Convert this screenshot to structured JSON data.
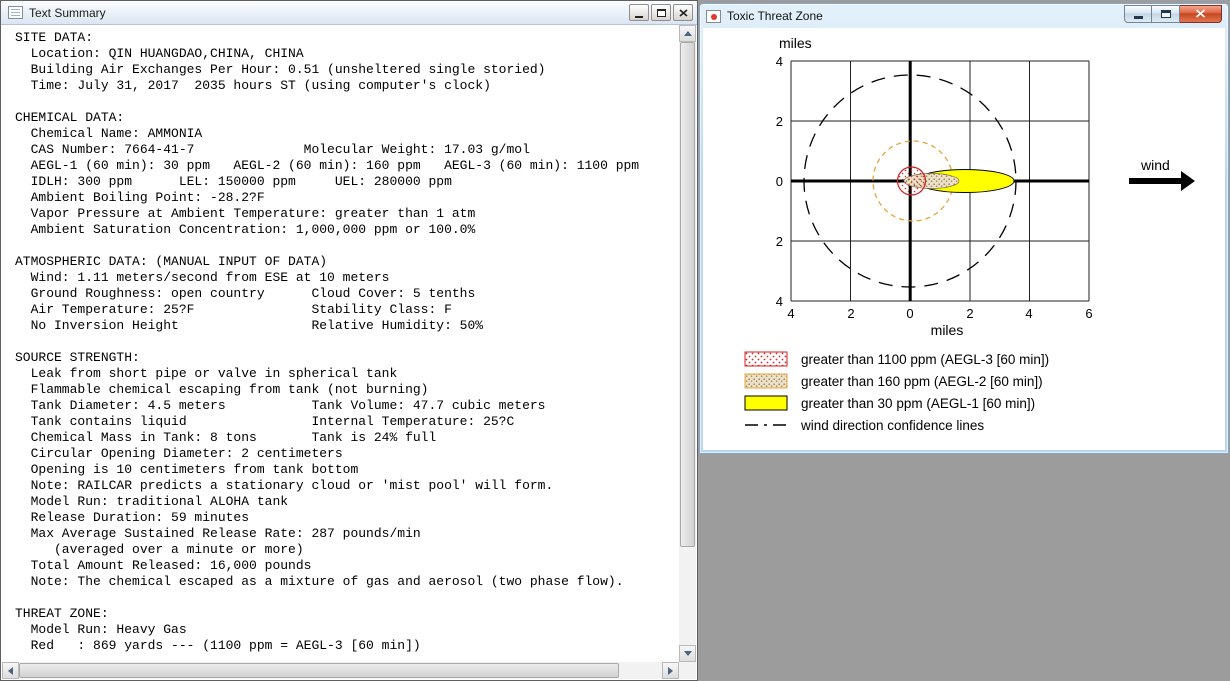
{
  "desktop": {
    "background_color": "#9c9c9c"
  },
  "text_summary_window": {
    "title": "Text Summary",
    "lines": [
      "SITE DATA:",
      "  Location: QIN HUANGDAO,CHINA, CHINA",
      "  Building Air Exchanges Per Hour: 0.51 (unsheltered single storied)",
      "  Time: July 31, 2017  2035 hours ST (using computer's clock)",
      "",
      "CHEMICAL DATA:",
      "  Chemical Name: AMMONIA",
      "  CAS Number: 7664-41-7              Molecular Weight: 17.03 g/mol",
      "  AEGL-1 (60 min): 30 ppm   AEGL-2 (60 min): 160 ppm   AEGL-3 (60 min): 1100 ppm",
      "  IDLH: 300 ppm      LEL: 150000 ppm     UEL: 280000 ppm",
      "  Ambient Boiling Point: -28.2?F",
      "  Vapor Pressure at Ambient Temperature: greater than 1 atm",
      "  Ambient Saturation Concentration: 1,000,000 ppm or 100.0%",
      "",
      "ATMOSPHERIC DATA: (MANUAL INPUT OF DATA)",
      "  Wind: 1.11 meters/second from ESE at 10 meters",
      "  Ground Roughness: open country      Cloud Cover: 5 tenths",
      "  Air Temperature: 25?F               Stability Class: F",
      "  No Inversion Height                 Relative Humidity: 50%",
      "",
      "SOURCE STRENGTH:",
      "  Leak from short pipe or valve in spherical tank",
      "  Flammable chemical escaping from tank (not burning)",
      "  Tank Diameter: 4.5 meters           Tank Volume: 47.7 cubic meters",
      "  Tank contains liquid                Internal Temperature: 25?C",
      "  Chemical Mass in Tank: 8 tons       Tank is 24% full",
      "  Circular Opening Diameter: 2 centimeters",
      "  Opening is 10 centimeters from tank bottom",
      "  Note: RAILCAR predicts a stationary cloud or 'mist pool' will form.",
      "  Model Run: traditional ALOHA tank",
      "  Release Duration: 59 minutes",
      "  Max Average Sustained Release Rate: 287 pounds/min",
      "     (averaged over a minute or more)",
      "  Total Amount Released: 16,000 pounds",
      "  Note: The chemical escaped as a mixture of gas and aerosol (two phase flow).",
      "",
      "THREAT ZONE:",
      "  Model Run: Heavy Gas",
      "  Red   : 869 yards --- (1100 ppm = AEGL-3 [60 min])"
    ]
  },
  "threat_zone_window": {
    "title": "Toxic Threat Zone",
    "plot": {
      "y_axis_title": "miles",
      "x_axis_title": "miles",
      "y_ticks": [
        "4",
        "2",
        "0",
        "2",
        "4"
      ],
      "x_ticks": [
        "4",
        "2",
        "0",
        "2",
        "4",
        "6"
      ],
      "wind_label": "wind"
    },
    "legend": [
      {
        "label": "greater than 1100 ppm (AEGL-3 [60 min])"
      },
      {
        "label": "greater than 160 ppm (AEGL-2 [60 min])"
      },
      {
        "label": "greater than 30 ppm (AEGL-1 [60 min])"
      },
      {
        "label": "wind direction confidence lines"
      }
    ],
    "chart_data": {
      "type": "area",
      "title": "Toxic Threat Zone",
      "xlabel": "miles",
      "ylabel": "miles",
      "xlim": [
        -4,
        6
      ],
      "ylim": [
        -4,
        4
      ],
      "grid": true,
      "wind": {
        "arrow_label": "wind",
        "blowing_toward": "+x direction of plot"
      },
      "zones": [
        {
          "name": "AEGL-3",
          "threshold_label": "greater than 1100 ppm (AEGL-3 [60 min])",
          "downwind_extent_miles": 0.49,
          "shape": "small red dotted circle at origin"
        },
        {
          "name": "AEGL-2",
          "threshold_label": "greater than 160 ppm (AEGL-2 [60 min])",
          "downwind_extent_miles": 1.6,
          "shape": "stippled lobe along +x axis"
        },
        {
          "name": "AEGL-1",
          "threshold_label": "greater than 30 ppm (AEGL-1 [60 min])",
          "downwind_extent_miles": 3.5,
          "shape": "solid yellow lobe along +x axis"
        }
      ],
      "wind_confidence_circle_radius_miles": 3.6,
      "aegl2_dashed_circle_radius_miles": 1.35
    }
  },
  "colors": {
    "aegl3_red": "#cc2222",
    "aegl2_orange": "#e8a33d",
    "aegl1_yellow": "#ffff00",
    "desktop_gray": "#9c9c9c"
  }
}
